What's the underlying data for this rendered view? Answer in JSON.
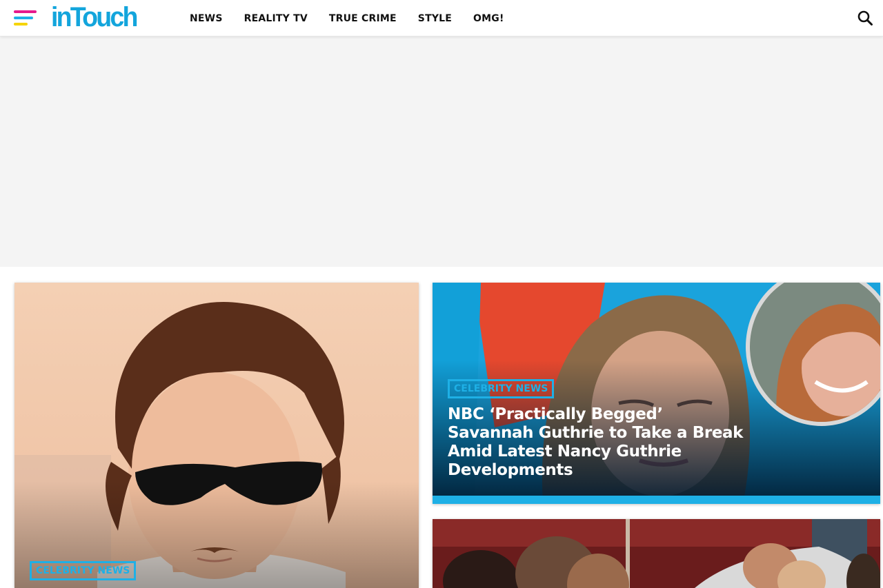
{
  "site": {
    "logo_text": "inTouch",
    "brand_color": "#1eb0e6",
    "menu_colors": [
      "#e6198c",
      "#1eb0e6",
      "#f5d400"
    ]
  },
  "nav": {
    "items": [
      {
        "label": "NEWS"
      },
      {
        "label": "REALITY TV"
      },
      {
        "label": "TRUE CRIME"
      },
      {
        "label": "STYLE"
      },
      {
        "label": "OMG!"
      }
    ]
  },
  "icons": {
    "menu": "hamburger-menu-icon",
    "search": "search-icon"
  },
  "articles": [
    {
      "category": "CELEBRITY NEWS",
      "headline": ""
    },
    {
      "category": "CELEBRITY NEWS",
      "headline": "NBC ‘Practically Begged’ Savannah Guthrie to Take a Break Amid Latest Nancy Guthrie Developments"
    },
    {
      "category": "",
      "headline": ""
    }
  ]
}
